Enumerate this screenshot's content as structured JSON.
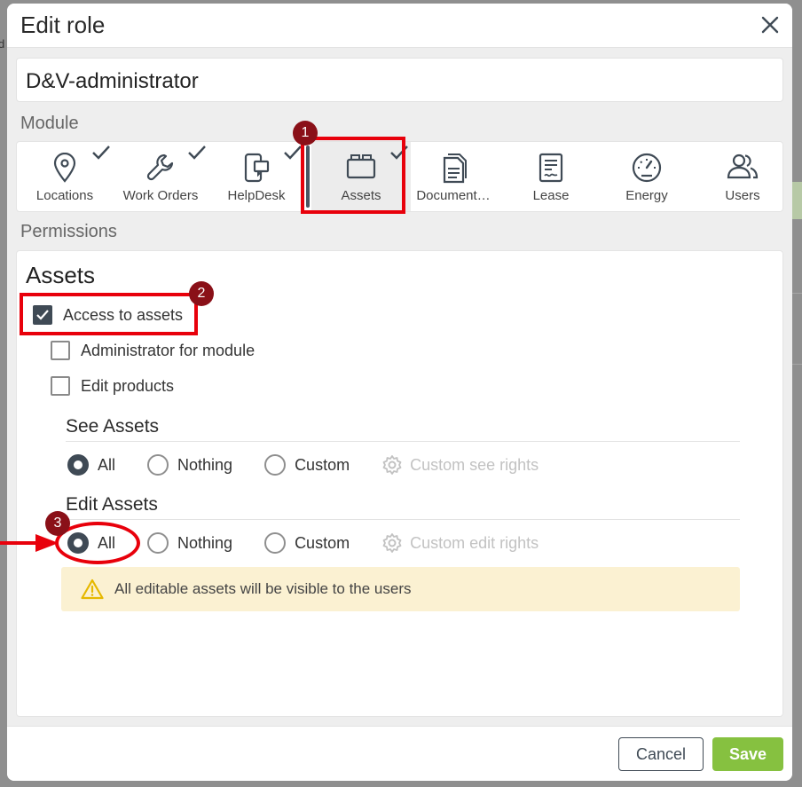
{
  "backdrop": {
    "edge_char": "d"
  },
  "modal": {
    "title": "Edit role",
    "role_name": "D&V-administrator",
    "module_label": "Module",
    "permissions_label": "Permissions"
  },
  "modules": [
    {
      "label": "Locations",
      "icon": "location-pin-icon",
      "checked": true,
      "active": false
    },
    {
      "label": "Work Orders",
      "icon": "wrench-icon",
      "checked": true,
      "active": false
    },
    {
      "label": "HelpDesk",
      "icon": "mobile-helpdesk-icon",
      "checked": true,
      "active": false
    },
    {
      "label": "Assets",
      "icon": "box-icon",
      "checked": true,
      "active": true
    },
    {
      "label": "Document…",
      "icon": "document-icon",
      "checked": false,
      "active": false
    },
    {
      "label": "Lease",
      "icon": "contract-icon",
      "checked": false,
      "active": false
    },
    {
      "label": "Energy",
      "icon": "gauge-icon",
      "checked": false,
      "active": false
    },
    {
      "label": "Users",
      "icon": "users-icon",
      "checked": false,
      "active": false
    }
  ],
  "permissions": {
    "title": "Assets",
    "access": {
      "label": "Access to assets",
      "checked": true
    },
    "admin": {
      "label": "Administrator for module",
      "checked": false
    },
    "edit_products": {
      "label": "Edit products",
      "checked": false
    },
    "see": {
      "title": "See Assets",
      "options": [
        "All",
        "Nothing",
        "Custom"
      ],
      "selected": "All",
      "custom_rights": "Custom see rights"
    },
    "edit": {
      "title": "Edit Assets",
      "options": [
        "All",
        "Nothing",
        "Custom"
      ],
      "selected": "All",
      "custom_rights": "Custom edit rights"
    },
    "warning": "All editable assets will be visible to the users"
  },
  "footer": {
    "cancel": "Cancel",
    "save": "Save"
  },
  "annotations": {
    "badge1": "1",
    "badge2": "2",
    "badge3": "3"
  },
  "colors": {
    "accent_dark": "#3f4a55",
    "save_green": "#86c140",
    "annotation_red": "#e8000b",
    "warning_bg": "#fbf1d2"
  }
}
